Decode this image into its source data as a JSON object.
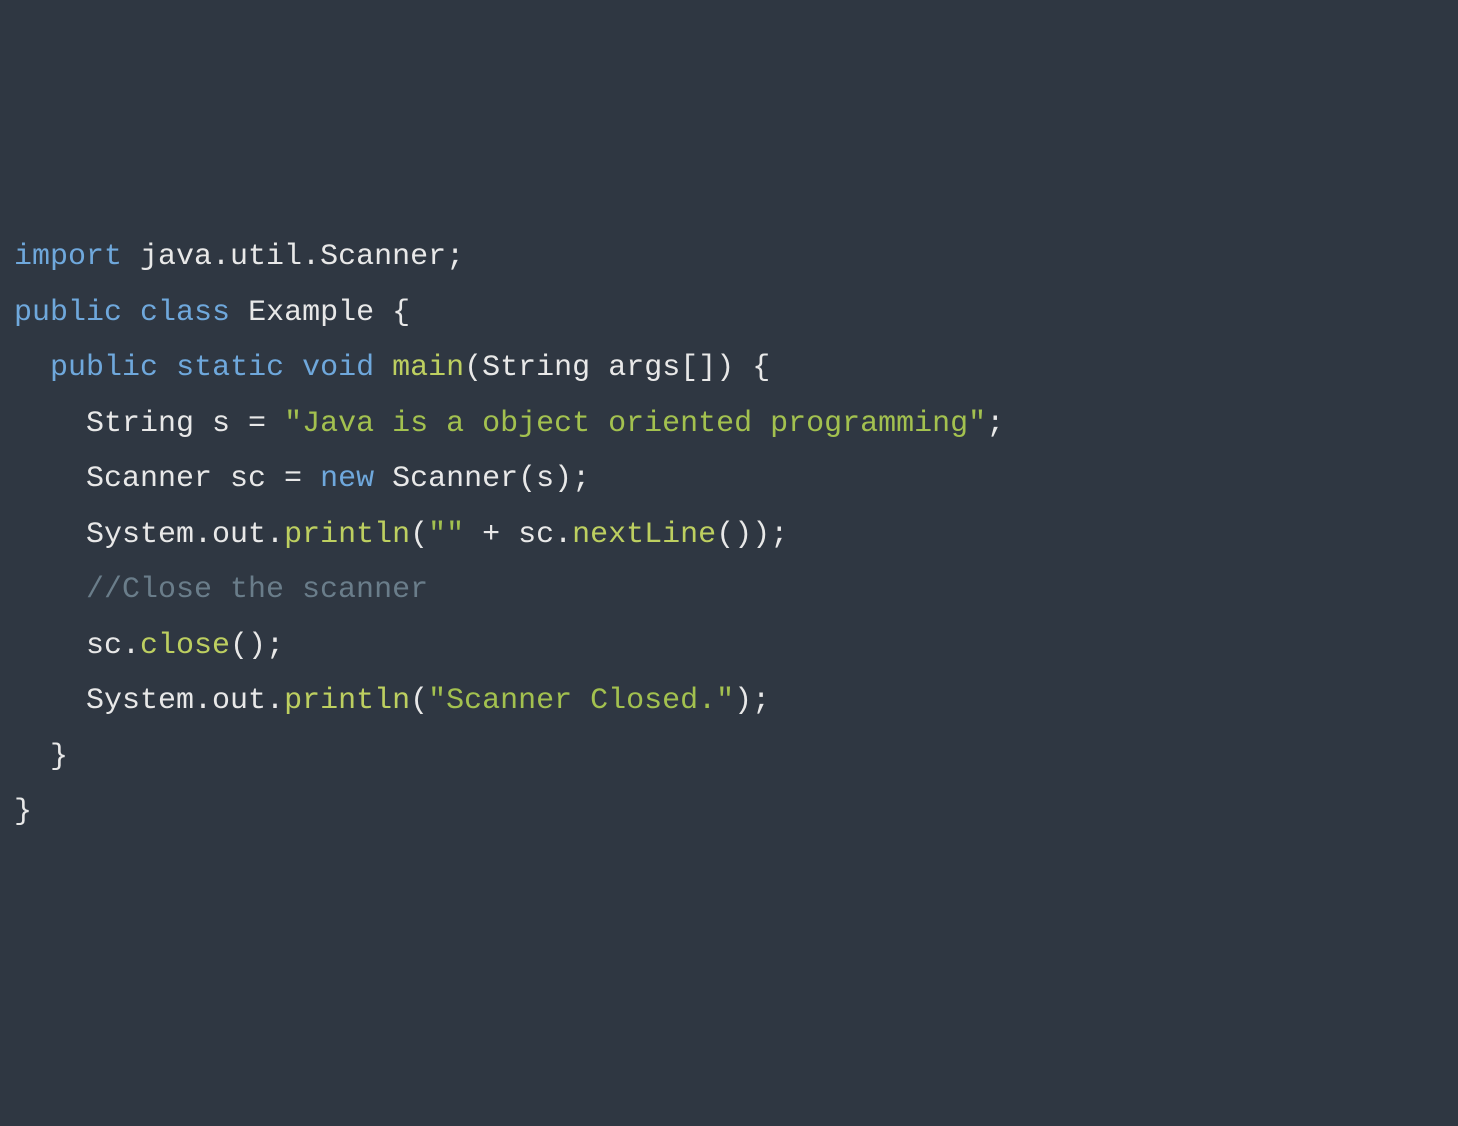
{
  "code": {
    "l1": {
      "kw_import": "import",
      "pkg": " java.util.Scanner",
      "semi": ";"
    },
    "l2": {
      "kw_public": "public",
      "kw_class": "class",
      "name": " Example ",
      "brace": "{"
    },
    "l3": {
      "indent": "  ",
      "kw_public": "public",
      "kw_static": "static",
      "kw_void": "void",
      "method": "main",
      "lparen": "(",
      "param_type": "String args",
      "brackets": "[]",
      "rparen_brace": ") {"
    },
    "l4": {
      "indent": "    ",
      "decl": "String s = ",
      "str": "\"Java is a object oriented programming\"",
      "semi": ";"
    },
    "l5": {
      "indent": "    ",
      "decl": "Scanner sc = ",
      "kw_new": "new",
      "rest": " Scanner(s);"
    },
    "l6": {
      "indent": "    ",
      "obj": "System.out.",
      "method": "println",
      "lparen": "(",
      "str": "\"\"",
      "plus": " + sc.",
      "method2": "nextLine",
      "rest": "());"
    },
    "l7": {
      "indent": "    ",
      "comment": "//Close the scanner"
    },
    "l8": {
      "indent": "    ",
      "obj": "sc.",
      "method": "close",
      "rest": "();"
    },
    "l9": {
      "indent": "    ",
      "obj": "System.out.",
      "method": "println",
      "lparen": "(",
      "str": "\"Scanner Closed.\"",
      "rest": ");"
    },
    "l10": {
      "indent": "  ",
      "brace": "}"
    },
    "l11": {
      "brace": "}"
    }
  }
}
